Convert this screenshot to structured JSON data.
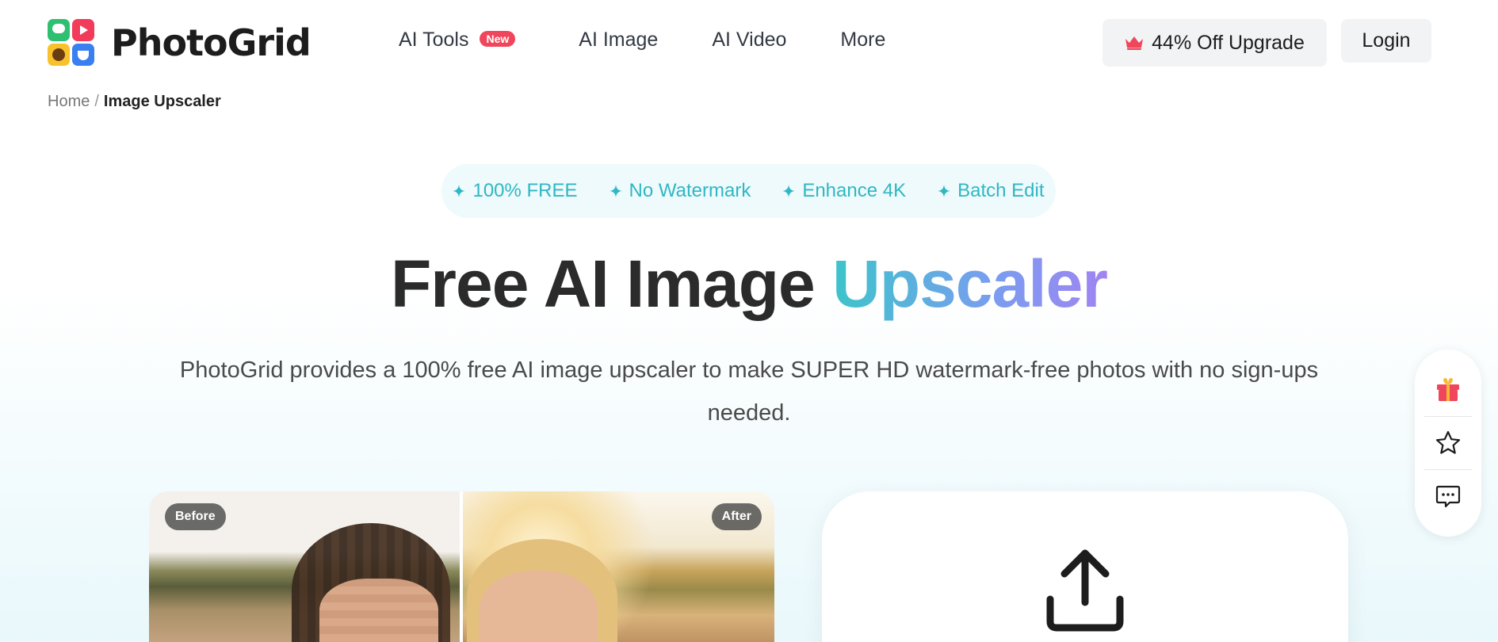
{
  "brand": {
    "name": "PhotoGrid"
  },
  "nav": {
    "items": [
      {
        "label": "AI Tools",
        "badge": "New"
      },
      {
        "label": "AI Image"
      },
      {
        "label": "AI Video"
      },
      {
        "label": "More"
      }
    ]
  },
  "header": {
    "upgrade_label": "44% Off Upgrade",
    "login_label": "Login"
  },
  "breadcrumb": {
    "home": "Home",
    "separator": "/",
    "current": "Image Upscaler"
  },
  "features": [
    "100% FREE",
    "No Watermark",
    "Enhance 4K",
    "Batch Edit"
  ],
  "hero": {
    "title_main": "Free AI Image ",
    "title_accent": "Upscaler",
    "subtitle": "PhotoGrid provides a 100% free AI image upscaler to make SUPER HD watermark-free photos with no sign-ups needed."
  },
  "compare": {
    "before_label": "Before",
    "after_label": "After"
  },
  "colors": {
    "accent_teal": "#2fb7c4",
    "gradient_start": "#3dc4cb",
    "gradient_end": "#a184f2",
    "badge_red": "#f0465c"
  },
  "icons": {
    "upgrade": "crown-icon",
    "feature": "sparkle-icon",
    "upload": "upload-icon",
    "side": [
      "gift-icon",
      "star-icon",
      "chat-icon"
    ]
  }
}
